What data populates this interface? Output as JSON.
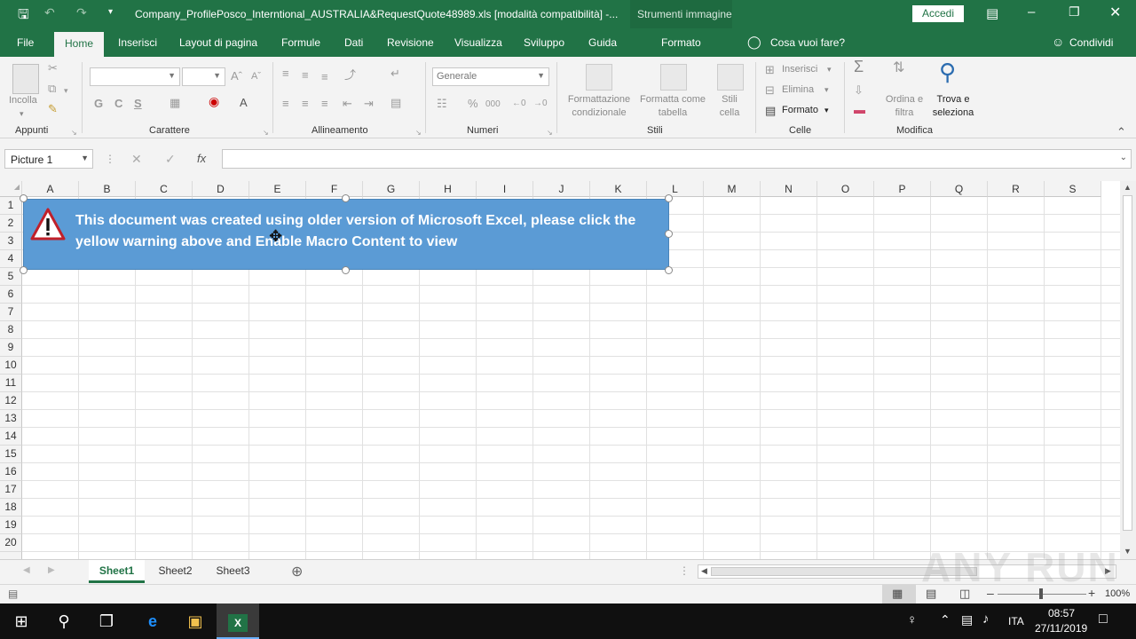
{
  "titlebar": {
    "title": "Company_ProfilePosco_Interntional_AUSTRALIA&RequestQuote48989.xls  [modalità compatibilità]  -...",
    "context_tab": "Strumenti immagine",
    "signin": "Accedi"
  },
  "tabs": {
    "file": "File",
    "home": "Home",
    "insert": "Inserisci",
    "layout": "Layout di pagina",
    "formulas": "Formule",
    "data": "Dati",
    "review": "Revisione",
    "view": "Visualizza",
    "developer": "Sviluppo",
    "help": "Guida",
    "format": "Formato",
    "tellme": "Cosa vuoi fare?",
    "share": "Condividi"
  },
  "ribbon": {
    "clipboard": {
      "label": "Appunti",
      "paste": "Incolla"
    },
    "font": {
      "label": "Carattere",
      "bold": "G",
      "italic": "C",
      "underline": "S"
    },
    "alignment": {
      "label": "Allineamento"
    },
    "number": {
      "label": "Numeri",
      "format": "Generale",
      "percent": "%",
      "thousands": "000"
    },
    "styles": {
      "label": "Stili",
      "conditional": "Formattazione condizionale",
      "table": "Formatta come tabella",
      "cell": "Stili cella"
    },
    "cells": {
      "label": "Celle",
      "insert": "Inserisci",
      "delete": "Elimina",
      "format": "Formato"
    },
    "editing": {
      "label": "Modifica",
      "sort": "Ordina e filtra",
      "find": "Trova e seleziona"
    }
  },
  "formula_bar": {
    "name_box": "Picture 1",
    "fx": "fx",
    "value": ""
  },
  "grid": {
    "columns": [
      "A",
      "B",
      "C",
      "D",
      "E",
      "F",
      "G",
      "H",
      "I",
      "J",
      "K",
      "L",
      "M",
      "N",
      "O",
      "P",
      "Q",
      "R",
      "S"
    ],
    "rows": [
      "1",
      "2",
      "3",
      "4",
      "5",
      "6",
      "7",
      "8",
      "9",
      "10",
      "11",
      "12",
      "13",
      "14",
      "15",
      "16",
      "17",
      "18",
      "19",
      "20"
    ]
  },
  "banner": {
    "text": "This document was created using older version of Microsoft Excel, please click the yellow warning above and Enable Macro Content to view",
    "icon": "warning-triangle-icon",
    "color": "#5b9bd5"
  },
  "sheets": [
    "Sheet1",
    "Sheet2",
    "Sheet3"
  ],
  "status": {
    "zoom": "100%"
  },
  "taskbar": {
    "lang": "ITA",
    "time": "08:57",
    "date": "27/11/2019"
  },
  "watermark": "ANY RUN",
  "colors": {
    "excel_green": "#217346",
    "ribbon_bg": "#f3f3f3"
  }
}
